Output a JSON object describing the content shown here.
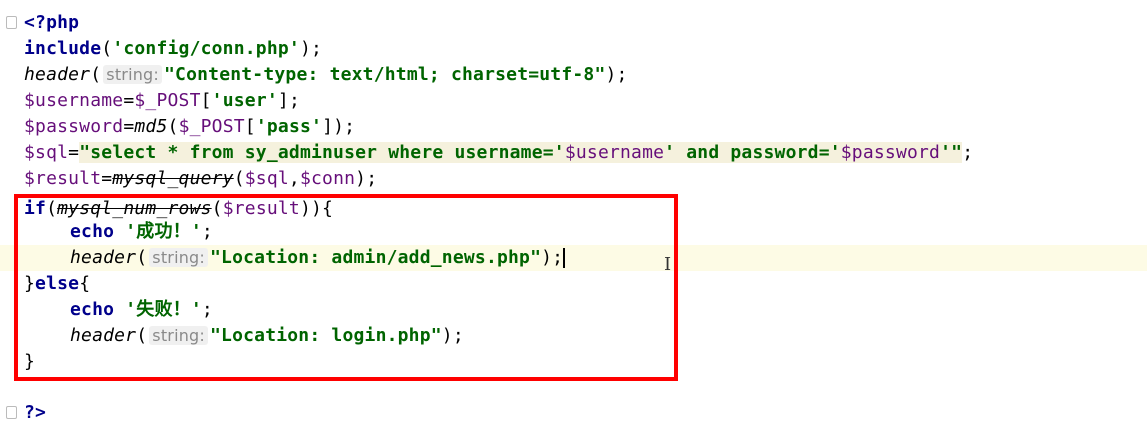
{
  "php_open": "<?php",
  "php_close": "?>",
  "include": {
    "kw": "include",
    "open": "(",
    "path": "'config/conn.php'",
    "close": ");"
  },
  "header1": {
    "fn": "header",
    "open": "(",
    "hint": "string:",
    "value": "\"Content-type: text/html; charset=utf-8\"",
    "close": ");"
  },
  "username": {
    "var": "$username",
    "eq": "=",
    "post": "$_POST",
    "open": "[",
    "key": "'user'",
    "close": "];"
  },
  "password": {
    "var": "$password",
    "eq": "=",
    "fn": "md5",
    "open": "(",
    "post": "$_POST",
    "bopen": "[",
    "key": "'pass'",
    "close": "]);"
  },
  "sql": {
    "var": "$sql",
    "eq": "=",
    "q1": "\"select * from sy_adminuser where username='",
    "v1": "$username",
    "q2": "' and password='",
    "v2": "$password",
    "q3": "'\"",
    "end": ";"
  },
  "result": {
    "var": "$result",
    "eq": "=",
    "fn": "mysql_query",
    "open": "(",
    "a1": "$sql",
    "comma": ",",
    "a2": "$conn",
    "close": ");"
  },
  "if_line": {
    "kw": "if",
    "open": "(",
    "fn": "mysql_num_rows",
    "p": "(",
    "arg": "$result",
    "close": ")){"
  },
  "echo_success": {
    "kw": "echo",
    "str": "'成功！'",
    "end": ";"
  },
  "header_admin": {
    "fn": "header",
    "open": "(",
    "hint": "string:",
    "value": "\"Location: admin/add_news.php\"",
    "close": ");"
  },
  "else_line": {
    "brace": "}",
    "kw": "else",
    "open": "{"
  },
  "echo_fail": {
    "kw": "echo",
    "str": "'失败！'",
    "end": ";"
  },
  "header_login": {
    "fn": "header",
    "open": "(",
    "hint": "string:",
    "value": "\"Location: login.php\"",
    "close": ");"
  },
  "close_brace": "}",
  "colors": {
    "keyword": "#00008b",
    "string": "#006400",
    "variable": "#660e7a",
    "highlight_box": "#ff0000"
  }
}
